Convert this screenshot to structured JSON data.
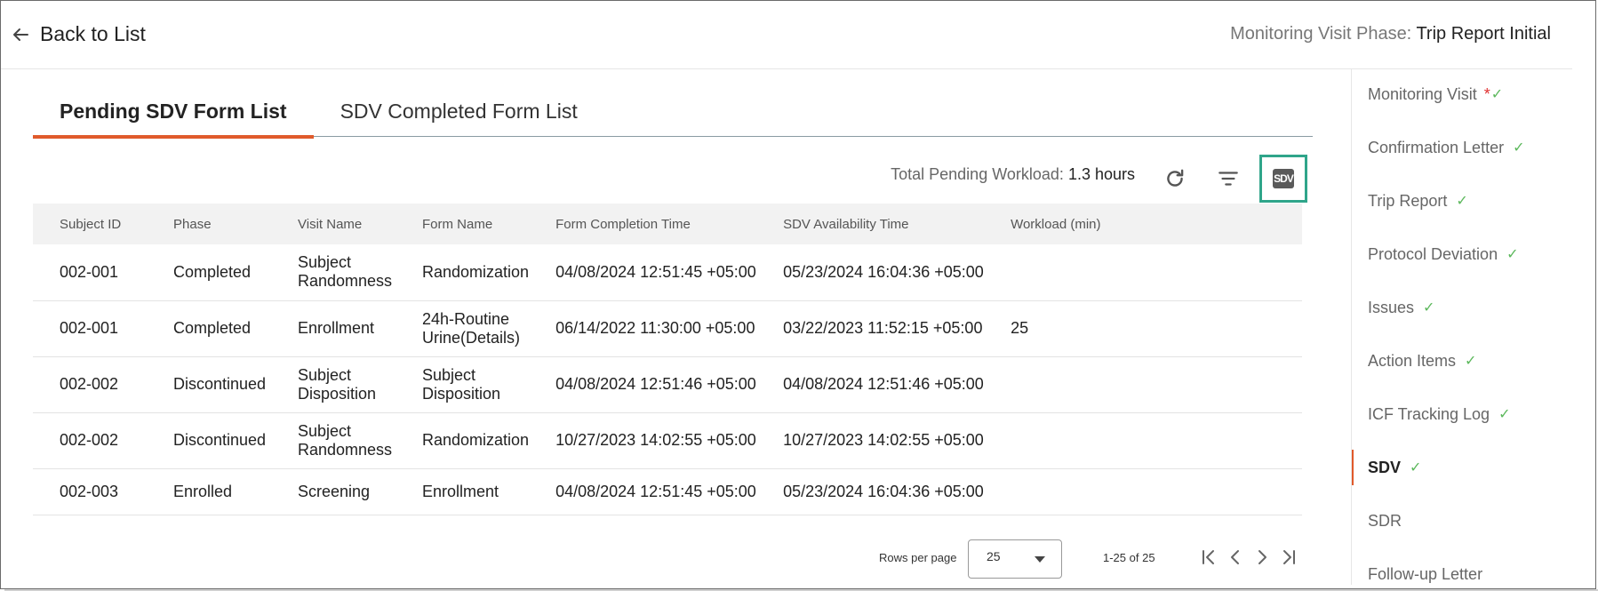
{
  "header": {
    "back_label": "Back to List",
    "phase_label": "Monitoring Visit Phase:",
    "phase_value": "Trip Report Initial"
  },
  "tabs": [
    {
      "label": "Pending SDV Form List",
      "active": true
    },
    {
      "label": "SDV Completed Form List",
      "active": false
    }
  ],
  "toolbar": {
    "workload_label": "Total Pending Workload:",
    "workload_value": "1.3 hours",
    "icons": [
      "refresh-icon",
      "filter-icon",
      "sdv-icon"
    ],
    "sdv_badge": "SDV"
  },
  "table": {
    "columns": [
      "Subject ID",
      "Phase",
      "Visit Name",
      "Form Name",
      "Form Completion Time",
      "SDV Availability Time",
      "Workload (min)"
    ],
    "rows": [
      [
        "002-001",
        "Completed",
        "Subject Randomness",
        "Randomization",
        "04/08/2024 12:51:45 +05:00",
        "05/23/2024 16:04:36 +05:00",
        ""
      ],
      [
        "002-001",
        "Completed",
        "Enrollment",
        "24h-Routine Urine(Details)",
        "06/14/2022 11:30:00 +05:00",
        "03/22/2023 11:52:15 +05:00",
        "25"
      ],
      [
        "002-002",
        "Discontinued",
        "Subject Disposition",
        "Subject Disposition",
        "04/08/2024 12:51:46 +05:00",
        "04/08/2024 12:51:46 +05:00",
        ""
      ],
      [
        "002-002",
        "Discontinued",
        "Subject Randomness",
        "Randomization",
        "10/27/2023 14:02:55 +05:00",
        "10/27/2023 14:02:55 +05:00",
        ""
      ],
      [
        "002-003",
        "Enrolled",
        "Screening",
        "Enrollment",
        "04/08/2024 12:51:45 +05:00",
        "05/23/2024 16:04:36 +05:00",
        ""
      ]
    ]
  },
  "pagination": {
    "rows_per_page_label": "Rows per page",
    "rows_per_page_value": "25",
    "range": "1-25 of 25"
  },
  "sidebar": {
    "items": [
      {
        "label": "Monitoring Visit",
        "required": "*",
        "checked": true,
        "active": false
      },
      {
        "label": "Confirmation Letter",
        "checked": true,
        "active": false
      },
      {
        "label": "Trip Report",
        "checked": true,
        "active": false
      },
      {
        "label": "Protocol Deviation",
        "checked": true,
        "active": false
      },
      {
        "label": "Issues",
        "checked": true,
        "active": false
      },
      {
        "label": "Action Items",
        "checked": true,
        "active": false
      },
      {
        "label": "ICF Tracking Log",
        "checked": true,
        "active": false
      },
      {
        "label": "SDV",
        "checked": true,
        "active": true
      },
      {
        "label": "SDR",
        "checked": false,
        "active": false
      },
      {
        "label": "Follow-up Letter",
        "checked": false,
        "active": false
      }
    ],
    "check_glyph": "✓"
  },
  "colors": {
    "accent": "#e05a2b",
    "check": "#5cb85c",
    "sdv_highlight": "#2fa58a"
  }
}
